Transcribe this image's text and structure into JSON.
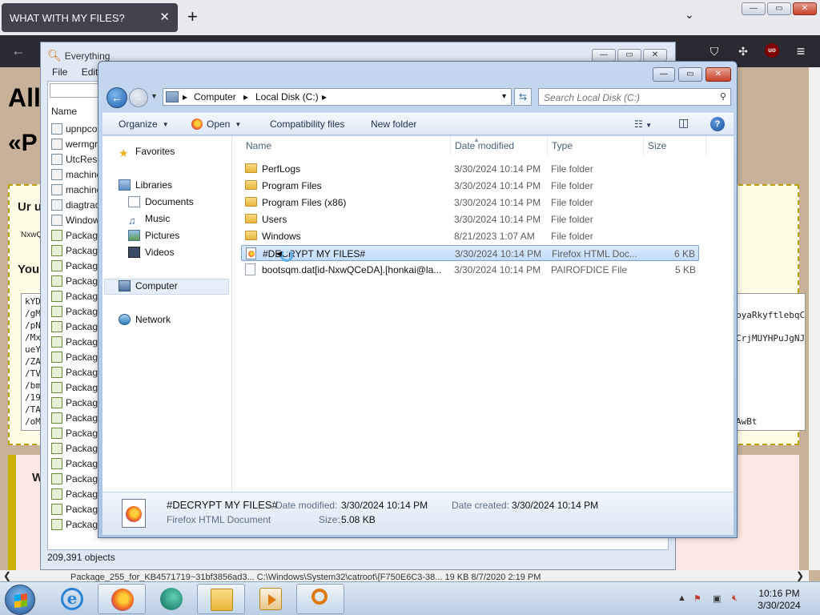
{
  "browser": {
    "tab_title": "WHAT WITH MY FILES?",
    "tab_close": "✕",
    "new_tab": "+",
    "list_tabs": "⌄",
    "back": "←",
    "toolbar_icons": [
      "pocket-icon",
      "extensions-icon",
      "ublock-icon",
      "menu-icon"
    ],
    "ublock_label": "uo",
    "menu_glyph": "≡"
  },
  "web_page": {
    "heading1": "All",
    "heading2": "«P",
    "box_title": "Ur u",
    "box_small": "NxwQ",
    "your_label": "You",
    "key_lines": [
      "kYD",
      "/gM",
      "/pN",
      "/Mx",
      "ueY",
      "/ZA",
      "/TV",
      "/bm",
      "/19",
      "/TA",
      "/oM"
    ],
    "key_right": [
      "byaRkyftlebqC",
      "CrjMUYHPuJgNJ",
      "AwBt"
    ],
    "what_title": "WH",
    "bullets": [
      "•",
      "•",
      "•"
    ]
  },
  "everything_window": {
    "title": "Everything",
    "menu": [
      "File",
      "Edit"
    ],
    "column_name": "Name",
    "rows": [
      {
        "name": "upnpco",
        "icon": "file"
      },
      {
        "name": "wermgr",
        "icon": "file"
      },
      {
        "name": "UtcReso",
        "icon": "file"
      },
      {
        "name": "machine",
        "icon": "file"
      },
      {
        "name": "machine",
        "icon": "file"
      },
      {
        "name": "diagtrac",
        "icon": "file"
      },
      {
        "name": "Window",
        "icon": "file"
      },
      {
        "name": "Package",
        "icon": "pkg"
      },
      {
        "name": "Package",
        "icon": "pkg"
      },
      {
        "name": "Package",
        "icon": "pkg"
      },
      {
        "name": "Package",
        "icon": "pkg"
      },
      {
        "name": "Package",
        "icon": "pkg"
      },
      {
        "name": "Package",
        "icon": "pkg"
      },
      {
        "name": "Package",
        "icon": "pkg"
      },
      {
        "name": "Package",
        "icon": "pkg"
      },
      {
        "name": "Package",
        "icon": "pkg"
      },
      {
        "name": "Package",
        "icon": "pkg"
      },
      {
        "name": "Package",
        "icon": "pkg"
      },
      {
        "name": "Package",
        "icon": "pkg"
      },
      {
        "name": "Package",
        "icon": "pkg"
      },
      {
        "name": "Package",
        "icon": "pkg"
      },
      {
        "name": "Package",
        "icon": "pkg"
      },
      {
        "name": "Package",
        "icon": "pkg"
      },
      {
        "name": "Package",
        "icon": "pkg"
      },
      {
        "name": "Package",
        "icon": "pkg"
      },
      {
        "name": "Package",
        "icon": "pkg"
      },
      {
        "name": "Package",
        "icon": "pkg"
      }
    ],
    "last_row": "Package_255_for_KB4571719~31bf3856ad3...    C:\\Windows\\System32\\catroot\\{F750E6C3-38...                    19 KB    8/7/2020 2:19 PM",
    "status": "209,391 objects"
  },
  "explorer": {
    "caption_buttons": [
      "—",
      "▭",
      "✕"
    ],
    "address": [
      "Computer",
      "Local Disk (C:)"
    ],
    "search_placeholder": "Search Local Disk (C:)",
    "commands": {
      "organize": "Organize",
      "open": "Open",
      "compat": "Compatibility files",
      "new_folder": "New folder"
    },
    "nav": {
      "favorites": "Favorites",
      "libraries": "Libraries",
      "documents": "Documents",
      "music": "Music",
      "pictures": "Pictures",
      "videos": "Videos",
      "computer": "Computer",
      "network": "Network"
    },
    "columns": {
      "name": "Name",
      "date": "Date modified",
      "type": "Type",
      "size": "Size"
    },
    "files": [
      {
        "name": "PerfLogs",
        "date": "3/30/2024 10:14 PM",
        "type": "File folder",
        "size": "",
        "icon": "folder"
      },
      {
        "name": "Program Files",
        "date": "3/30/2024 10:14 PM",
        "type": "File folder",
        "size": "",
        "icon": "folder"
      },
      {
        "name": "Program Files (x86)",
        "date": "3/30/2024 10:14 PM",
        "type": "File folder",
        "size": "",
        "icon": "folder"
      },
      {
        "name": "Users",
        "date": "3/30/2024 10:14 PM",
        "type": "File folder",
        "size": "",
        "icon": "folder"
      },
      {
        "name": "Windows",
        "date": "8/21/2023 1:07 AM",
        "type": "File folder",
        "size": "",
        "icon": "folder"
      },
      {
        "name": "#DECRYPT MY FILES#",
        "date": "3/30/2024 10:14 PM",
        "type": "Firefox HTML Doc...",
        "size": "6 KB",
        "icon": "html",
        "selected": true
      },
      {
        "name": "bootsqm.dat[id-NxwQCeDA].[honkai@la...",
        "date": "3/30/2024 10:14 PM",
        "type": "PAIROFDICE File",
        "size": "5 KB",
        "icon": "doc"
      }
    ],
    "details": {
      "name": "#DECRYPT MY FILES#",
      "type": "Firefox HTML Document",
      "date_modified_label": "Date modified:",
      "date_modified": "3/30/2024 10:14 PM",
      "date_created_label": "Date created:",
      "date_created": "3/30/2024 10:14 PM",
      "size_label": "Size:",
      "size": "5.08 KB"
    }
  },
  "taskbar": {
    "apps": [
      "internet-explorer",
      "firefox",
      "cortana-like",
      "file-explorer",
      "media-player",
      "everything-search"
    ],
    "clock_time": "10:16 PM",
    "clock_date": "3/30/2024"
  }
}
